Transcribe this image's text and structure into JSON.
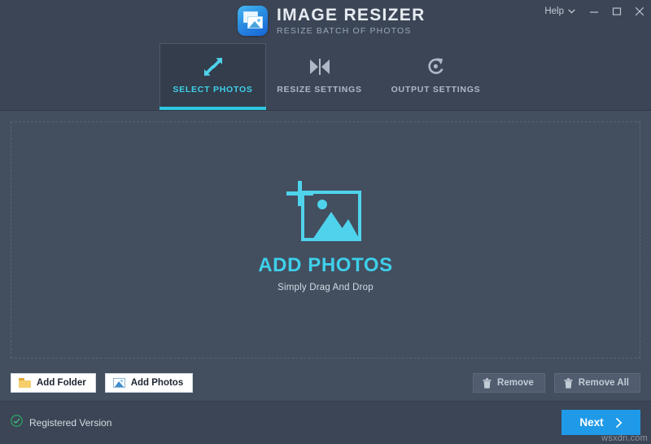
{
  "window": {
    "brand_icon": "app-photos-icon",
    "title": "IMAGE RESIZER",
    "subtitle": "RESIZE BATCH OF PHOTOS",
    "help_label": "Help",
    "help_chevron_icon": "chevron-down-icon",
    "minimize_icon": "minimize-icon",
    "maximize_icon": "maximize-icon",
    "close_icon": "close-icon"
  },
  "tabs": [
    {
      "label": "SELECT PHOTOS",
      "icon": "resize-arrows-icon",
      "active": true
    },
    {
      "label": "RESIZE SETTINGS",
      "icon": "compress-inward-icon",
      "active": false
    },
    {
      "label": "OUTPUT SETTINGS",
      "icon": "circular-arrow-icon",
      "active": false
    }
  ],
  "dropzone": {
    "icon": "add-photo-frame-icon",
    "title": "ADD PHOTOS",
    "subtitle": "Simply Drag And Drop"
  },
  "actions": {
    "add_folder": {
      "label": "Add Folder",
      "icon": "folder-icon"
    },
    "add_photos": {
      "label": "Add Photos",
      "icon": "photo-icon"
    },
    "remove": {
      "label": "Remove",
      "icon": "trash-icon"
    },
    "remove_all": {
      "label": "Remove All",
      "icon": "trash-icon"
    }
  },
  "footer": {
    "registered_label": "Registered Version",
    "registered_icon": "check-circle-icon",
    "next_label": "Next",
    "next_icon": "chevron-right-icon"
  },
  "watermark": "wsxdn.com",
  "colors": {
    "accent_cyan": "#3ecfe9",
    "accent_blue": "#1f9ae8",
    "window_bg": "#3b4555",
    "content_bg": "#434e5f",
    "active_tab_bg": "#333d4c",
    "registered_green": "#2f9e63"
  }
}
